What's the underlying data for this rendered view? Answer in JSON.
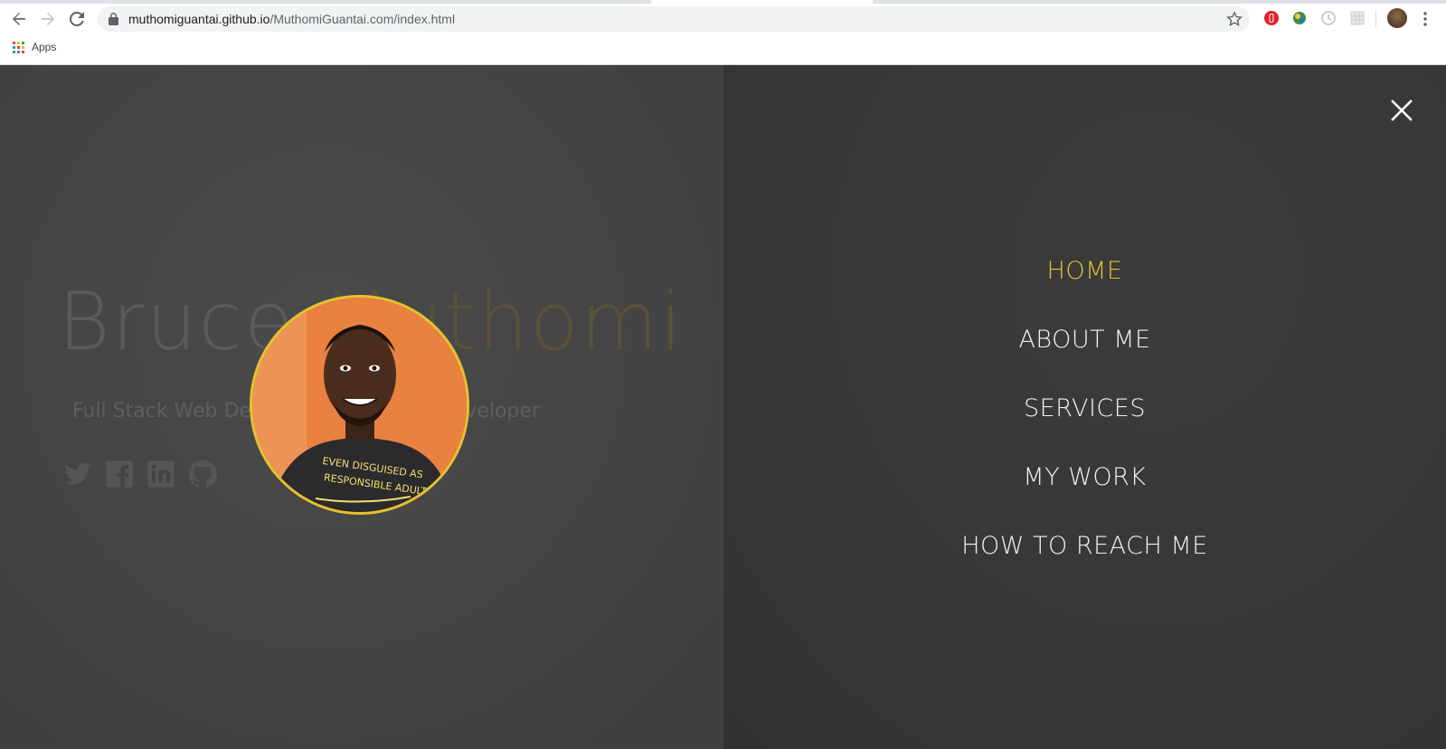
{
  "browser": {
    "url_domain": "muthomiguantai.github.io",
    "url_path": "/MuthomiGuantai.com/index.html",
    "bookmarks": {
      "apps_label": "Apps"
    },
    "icons": [
      "back-icon",
      "forward-icon",
      "reload-icon",
      "lock-icon",
      "star-icon",
      "menu-icon"
    ]
  },
  "hero": {
    "first_name": "Bruce ",
    "last_name": "Muthomi",
    "tagline": "Full Stack Web Developer & Android Developer",
    "socials": [
      "twitter-icon",
      "facebook-icon",
      "linkedin-icon",
      "github-icon"
    ]
  },
  "menu": {
    "items": [
      {
        "label": "HOME",
        "active": true
      },
      {
        "label": "ABOUT ME",
        "active": false
      },
      {
        "label": "SERVICES",
        "active": false
      },
      {
        "label": "MY WORK",
        "active": false
      },
      {
        "label": "HOW TO REACH ME",
        "active": false
      }
    ]
  },
  "colors": {
    "accent": "#e5c22d",
    "overlay_left": "#444444",
    "overlay_right": "#363636",
    "menu_text": "#f0f0f0"
  }
}
